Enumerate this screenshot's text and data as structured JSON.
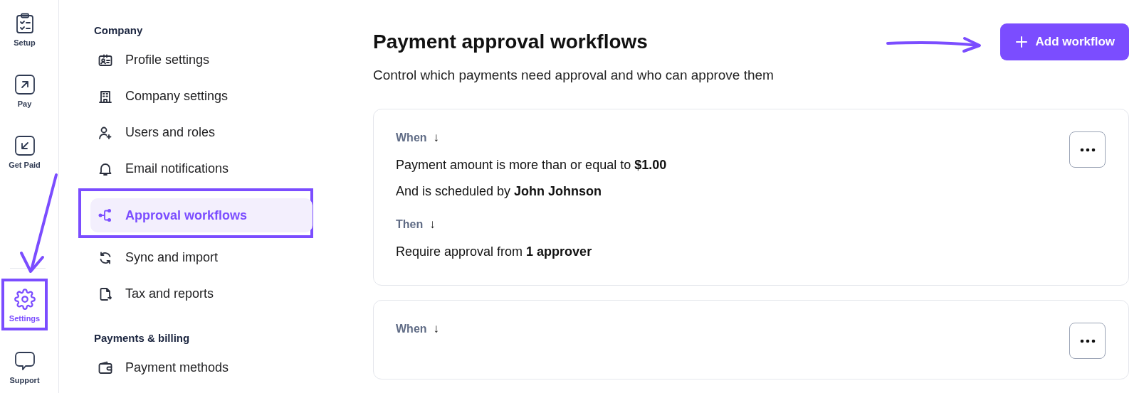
{
  "rail": {
    "items": [
      {
        "label": "Setup",
        "selected": false,
        "highlighted": false,
        "pointer_arrow": false
      },
      {
        "label": "Pay",
        "selected": false,
        "highlighted": false,
        "pointer_arrow": false
      },
      {
        "label": "Get Paid",
        "selected": false,
        "highlighted": false,
        "pointer_arrow": false
      },
      {
        "label": "Settings",
        "selected": true,
        "highlighted": true,
        "pointer_arrow": true
      },
      {
        "label": "Support",
        "selected": false,
        "highlighted": false,
        "pointer_arrow": false
      }
    ]
  },
  "settings_nav": {
    "sections": [
      {
        "heading": "Company",
        "items": [
          {
            "label": "Profile settings",
            "selected": false,
            "highlighted": false
          },
          {
            "label": "Company settings",
            "selected": false,
            "highlighted": false
          },
          {
            "label": "Users and roles",
            "selected": false,
            "highlighted": false
          },
          {
            "label": "Email notifications",
            "selected": false,
            "highlighted": false
          },
          {
            "label": "Approval workflows",
            "selected": true,
            "highlighted": true
          },
          {
            "label": "Sync and import",
            "selected": false,
            "highlighted": false
          },
          {
            "label": "Tax and reports",
            "selected": false,
            "highlighted": false
          }
        ]
      },
      {
        "heading": "Payments & billing",
        "items": [
          {
            "label": "Payment methods",
            "selected": false,
            "highlighted": false
          }
        ]
      }
    ]
  },
  "header": {
    "title": "Payment approval workflows",
    "subtitle": "Control which payments need approval and who can approve them",
    "add_button": {
      "label": "Add workflow",
      "pointer_arrow": true
    }
  },
  "workflows": [
    {
      "when_label": "When",
      "when_arrow": "↓",
      "conditions": [
        "Payment amount is more than or equal to **$1.00**",
        "And is scheduled by **John Johnson**"
      ],
      "then_label": "Then",
      "then_arrow": "↓",
      "actions": [
        "Require approval from **1 approver**"
      ]
    },
    {
      "when_label": "When",
      "when_arrow": "↓"
    }
  ]
}
